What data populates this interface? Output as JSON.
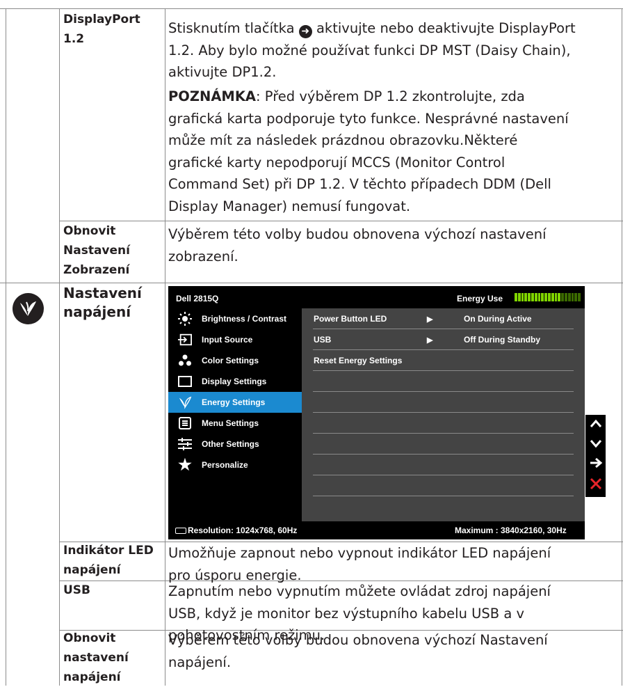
{
  "rows": {
    "displayport": {
      "label_line1": "DisplayPort",
      "label_line2": "1.2",
      "desc_pre": "Stisknutím tlačítka",
      "desc_post": "aktivujte nebo deaktivujte DisplayPort",
      "desc_line2": "1.2. Aby bylo možné používat funkci DP MST (Daisy Chain),",
      "desc_line3": "aktivujte DP1.2.",
      "note_bold": "POZNÁMKA",
      "note_line1": ": Před výběrem DP 1.2 zkontrolujte, zda",
      "note_line2": "grafická karta podporuje tyto funkce. Nesprávné nastavení",
      "note_line3": "může mít za následek prázdnou obrazovku.Některé",
      "note_line4": "grafické karty nepodporují MCCS (Monitor Control",
      "note_line5": "Command Set) při DP 1.2. V těchto případech DDM (Dell",
      "note_line6": "Display Manager) nemusí fungovat."
    },
    "reset_display": {
      "label_line1": "Obnovit",
      "label_line2": "Nastavení",
      "label_line3": "Zobrazení",
      "desc_line1": "Výběrem této volby budou obnovena výchozí nastavení",
      "desc_line2": "zobrazení."
    },
    "power_settings": {
      "label_line1": "Nastavení",
      "label_line2": "napájení"
    },
    "power_led": {
      "label_line1": "Indikátor LED",
      "label_line2": "napájení",
      "desc_line1": "Umožňuje zapnout nebo vypnout indikátor LED napájení",
      "desc_line2": "pro úsporu energie."
    },
    "usb": {
      "label": "USB",
      "desc_line1": "Zapnutím nebo vypnutím můžete ovládat zdroj napájení",
      "desc_line2": "USB, když je monitor bez výstupního kabelu USB a v",
      "desc_line3": "pohotovostním režimu."
    },
    "reset_power": {
      "label_line1": "Obnovit",
      "label_line2": "nastavení",
      "label_line3": "napájení",
      "desc_line1": "Výběrem této volby budou obnovena výchozí Nastavení",
      "desc_line2": "napájení."
    }
  },
  "osd": {
    "title": "Dell 2815Q",
    "energy_label": "Energy Use",
    "energy_level": 0.7,
    "menu": [
      {
        "label": "Brightness / Contrast",
        "icon": "brightness-icon"
      },
      {
        "label": "Input Source",
        "icon": "input-source-icon"
      },
      {
        "label": "Color Settings",
        "icon": "color-settings-icon"
      },
      {
        "label": "Display Settings",
        "icon": "display-settings-icon"
      },
      {
        "label": "Energy Settings",
        "icon": "energy-settings-icon",
        "selected": true
      },
      {
        "label": "Menu Settings",
        "icon": "menu-settings-icon"
      },
      {
        "label": "Other Settings",
        "icon": "other-settings-icon"
      },
      {
        "label": "Personalize",
        "icon": "star-icon"
      }
    ],
    "submenu": [
      {
        "label": "Power Button LED",
        "value": "On During Active"
      },
      {
        "label": "USB",
        "value": "Off During Standby"
      },
      {
        "label": "Reset Energy Settings",
        "value": ""
      }
    ],
    "resolution": "Resolution: 1024x768,  60Hz",
    "maximum": "Maximum : 3840x2160,  30Hz",
    "accent": "#1b8ad0"
  },
  "side_buttons": [
    "up-arrow-icon",
    "down-arrow-icon",
    "right-arrow-icon",
    "close-icon"
  ]
}
